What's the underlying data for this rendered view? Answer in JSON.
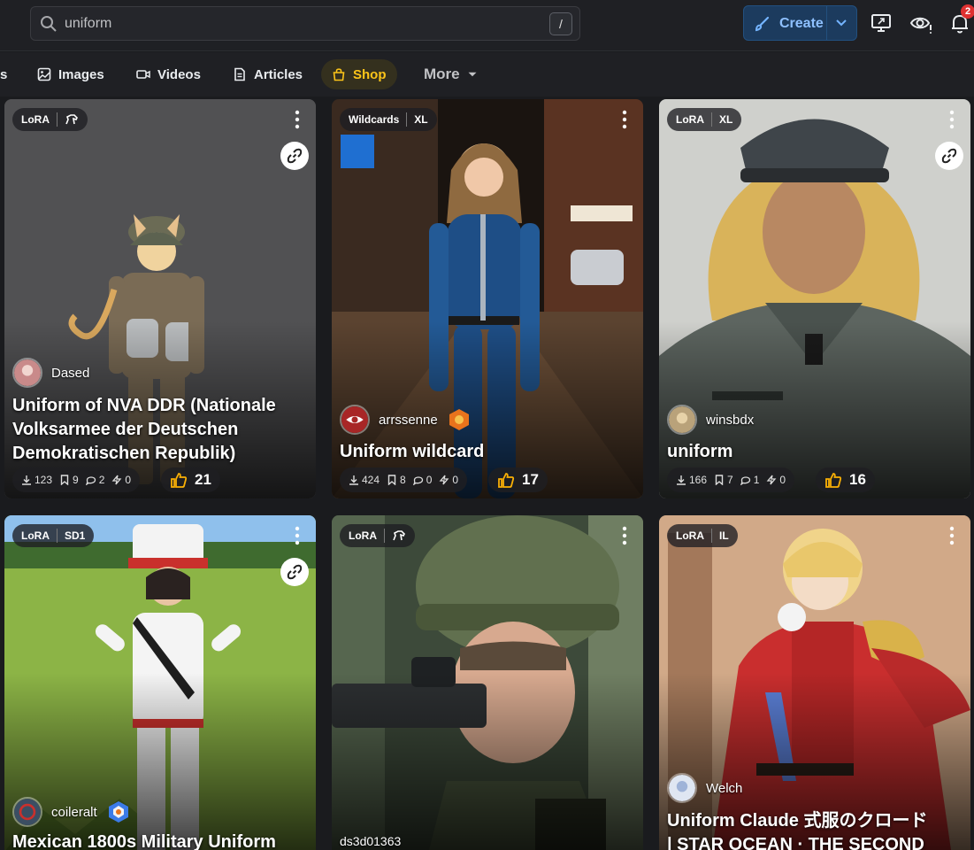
{
  "search": {
    "value": "uniform",
    "shortcut": "/"
  },
  "header": {
    "create_label": "Create",
    "notification_count": "2"
  },
  "tabs": {
    "partial": "s",
    "images": "Images",
    "videos": "Videos",
    "articles": "Articles",
    "shop": "Shop",
    "more": "More"
  },
  "colors": {
    "accent": "#74b4ff",
    "shop": "#fcc419",
    "like": "#fab005",
    "background": "#1a1b1e"
  },
  "cards": [
    {
      "tags": [
        "LoRA"
      ],
      "tag_icon": "horse-icon",
      "author": "Dased",
      "title": "Uniform of NVA DDR (Nationale Volksarmee der Deutschen Demokratischen Republik)",
      "downloads": "123",
      "saves": "9",
      "comments": "2",
      "buzz": "0",
      "likes": "21"
    },
    {
      "tags": [
        "Wildcards",
        "XL"
      ],
      "author": "arrssenne",
      "title": "Uniform wildcard",
      "downloads": "424",
      "saves": "8",
      "comments": "0",
      "buzz": "0",
      "likes": "17"
    },
    {
      "tags": [
        "LoRA",
        "XL"
      ],
      "author": "winsbdx",
      "title": "uniform",
      "downloads": "166",
      "saves": "7",
      "comments": "1",
      "buzz": "0",
      "likes": "16"
    },
    {
      "tags": [
        "LoRA",
        "SD1"
      ],
      "author": "coileralt",
      "title": "Mexican 1800s Military Uniform"
    },
    {
      "tags": [
        "LoRA"
      ],
      "tag_icon": "horse-icon",
      "author": "ds3d01363"
    },
    {
      "tags": [
        "LoRA",
        "IL"
      ],
      "author": "Welch",
      "title_line1": "Uniform Claude 式服のクロード",
      "title_line2": "| STAR OCEAN · THE SECOND"
    }
  ]
}
